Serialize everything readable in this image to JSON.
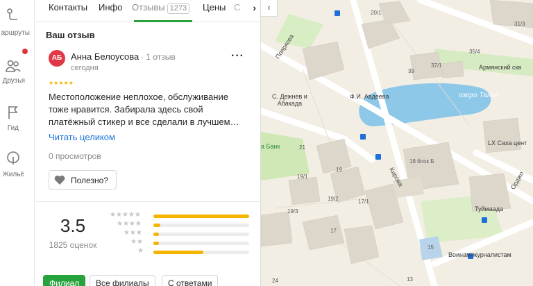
{
  "nav": {
    "routes_label": "аршруты",
    "friends_label": "Друзья",
    "guide_label": "Гид",
    "housing_label": "Жильё"
  },
  "tabs": {
    "contacts": "Контакты",
    "info": "Инфо",
    "reviews": "Отзывы",
    "reviews_count": "1273",
    "prices": "Цены",
    "more_partial": "С"
  },
  "review": {
    "section_title": "Ваш отзыв",
    "avatar_initials": "АБ",
    "author": "Анна Белоусова",
    "author_reviews": "· 1 отзыв",
    "date": "сегодня",
    "stars": "★★★★★",
    "text": "Местоположение неплохое, обслуживание тоже нравится. Забирала здесь свой платёжный стикер и все сделали в лучшем…",
    "read_more": "Читать целиком",
    "views": "0 просмотров",
    "helpful": "Полезно?"
  },
  "rating": {
    "value": "3.5",
    "count": "1825 оценок",
    "distribution": [
      {
        "stars": "★★★★★",
        "fraction": 1.0
      },
      {
        "stars": "★★★★",
        "fraction": 0.07
      },
      {
        "stars": "★★★",
        "fraction": 0.06
      },
      {
        "stars": "★★",
        "fraction": 0.06
      },
      {
        "stars": "★",
        "fraction": 0.52
      }
    ]
  },
  "filters": {
    "branch": "Филиал",
    "all_branches": "Все филиалы",
    "with_answers": "С ответами"
  },
  "map": {
    "labels": {
      "poyarkova": "Пояркова",
      "kirova": "Кирова",
      "ordzh": "Орджо",
      "lake": "озеро Талое",
      "armenian": "Армянский скв",
      "dezhnev": "С. Дежнев и\nАбакада",
      "avdeev": "Ф.И. Авдеева",
      "bank": "а Банк",
      "lx": "LX Саха цент",
      "tuymaada": "Туймаада",
      "voinam": "Воинам-журналистам",
      "b20_1": "20/1",
      "b31_3": "31/3",
      "b35_4": "35/4",
      "b37_1": "37/1",
      "b39": "39",
      "b21": "21",
      "b18_6": "18 блок Б",
      "b19": "19",
      "b19_1": "19/1",
      "b19_2": "19/2",
      "b19_3": "19/3",
      "b17_1": "17/1",
      "b17": "17",
      "b15": "15",
      "b13": "13",
      "b24": "24"
    }
  }
}
